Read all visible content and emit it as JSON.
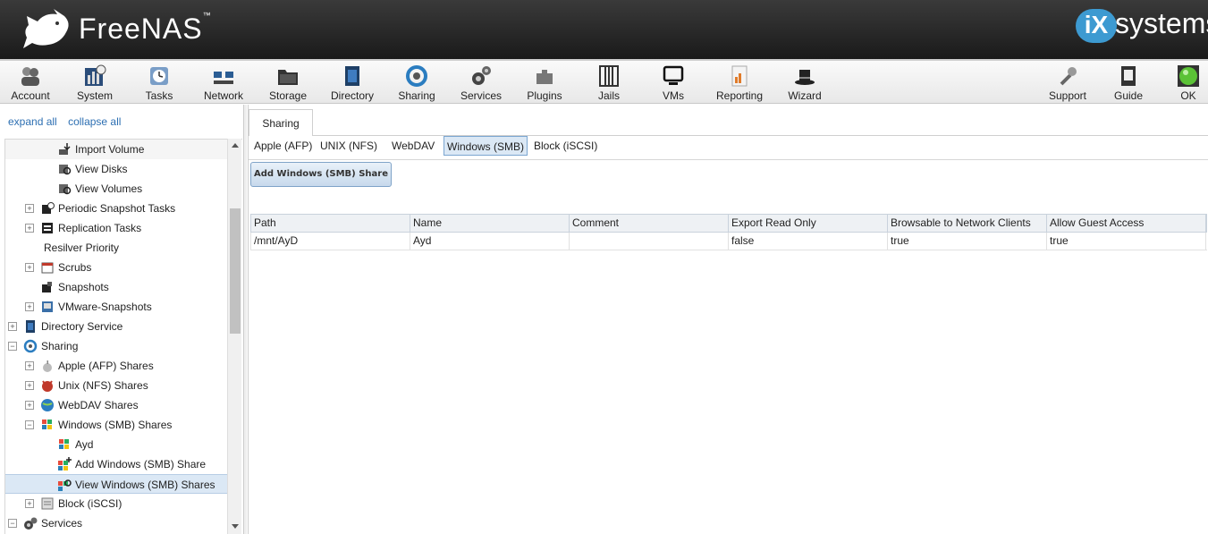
{
  "header": {
    "brand": "FreeNAS",
    "brand_tm": "™",
    "vendor_badge": "iX",
    "vendor_text": "systems"
  },
  "toolbar": {
    "items": [
      {
        "label": "Account",
        "icon": "account-icon"
      },
      {
        "label": "System",
        "icon": "system-icon"
      },
      {
        "label": "Tasks",
        "icon": "tasks-icon"
      },
      {
        "label": "Network",
        "icon": "network-icon"
      },
      {
        "label": "Storage",
        "icon": "storage-icon"
      },
      {
        "label": "Directory",
        "icon": "directory-icon"
      },
      {
        "label": "Sharing",
        "icon": "sharing-icon"
      },
      {
        "label": "Services",
        "icon": "services-icon"
      },
      {
        "label": "Plugins",
        "icon": "plugins-icon"
      },
      {
        "label": "Jails",
        "icon": "jails-icon"
      },
      {
        "label": "VMs",
        "icon": "vms-icon"
      },
      {
        "label": "Reporting",
        "icon": "reporting-icon"
      },
      {
        "label": "Wizard",
        "icon": "wizard-icon"
      },
      {
        "label": "Support",
        "icon": "support-icon"
      },
      {
        "label": "Guide",
        "icon": "guide-icon"
      },
      {
        "label": "OK",
        "icon": "alert-ok-icon"
      }
    ]
  },
  "tree": {
    "expand_all": "expand all",
    "collapse_all": "collapse all",
    "nodes": [
      {
        "label": "Import Volume"
      },
      {
        "label": "View Disks"
      },
      {
        "label": "View Volumes"
      },
      {
        "label": "Periodic Snapshot Tasks"
      },
      {
        "label": "Replication Tasks"
      },
      {
        "label": "Resilver Priority"
      },
      {
        "label": "Scrubs"
      },
      {
        "label": "Snapshots"
      },
      {
        "label": "VMware-Snapshots"
      },
      {
        "label": "Directory Service"
      },
      {
        "label": "Sharing"
      },
      {
        "label": "Apple (AFP) Shares"
      },
      {
        "label": "Unix (NFS) Shares"
      },
      {
        "label": "WebDAV Shares"
      },
      {
        "label": "Windows (SMB) Shares"
      },
      {
        "label": "Ayd"
      },
      {
        "label": "Add Windows (SMB) Share"
      },
      {
        "label": "View Windows (SMB) Shares"
      },
      {
        "label": "Block (iSCSI)"
      },
      {
        "label": "Services"
      }
    ]
  },
  "content": {
    "main_tab": "Sharing",
    "subtabs": [
      "Apple (AFP)",
      "UNIX (NFS)",
      "WebDAV",
      "Windows (SMB)",
      "Block (iSCSI)"
    ],
    "selected_subtab": "Windows (SMB)",
    "add_button": "Add Windows (SMB) Share",
    "columns": [
      "Path",
      "Name",
      "Comment",
      "Export Read Only",
      "Browsable to Network Clients",
      "Allow Guest Access"
    ],
    "rows": [
      [
        "/mnt/AyD",
        "Ayd",
        "",
        "false",
        "true",
        "true"
      ]
    ]
  },
  "colors": {
    "accent": "#2d6fb2",
    "selected_bg": "#dbe8f5",
    "header_dark": "#1a1a1a",
    "ix_blue": "#3d9ad1"
  }
}
